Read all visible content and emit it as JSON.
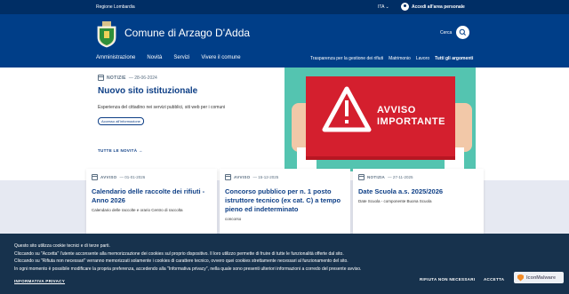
{
  "topbar": {
    "region": "Regione Lombardia",
    "language": "ITA",
    "login": "Accedi all'area personale"
  },
  "header": {
    "site_title": "Comune di Arzago D'Adda",
    "search_label": "Cerca",
    "nav_main": [
      "Amministrazione",
      "Novità",
      "Servizi",
      "Vivere il comune"
    ],
    "nav_secondary": [
      "Trasparenza per la gestione dei rifiuti",
      "Matrimonio",
      "Lavoro"
    ],
    "nav_all": "Tutti gli argomenti"
  },
  "featured": {
    "category": "NOTIZIE",
    "date": "— 28-06-2024",
    "title": "Nuovo sito istituzionale",
    "description": "Esperienza del cittadino nei servizi pubblici, siti web per i comuni",
    "tag": "Accesso all'informazione",
    "all_news": "TUTTE LE NOVITÀ"
  },
  "hero": {
    "sign_line1": "AVVISO",
    "sign_line2": "IMPORTANTE"
  },
  "cards": [
    {
      "category": "AVVISO",
      "date": "— 01-01-2026",
      "title": "Calendario delle raccolte dei rifiuti - Anno 2026",
      "description": "Calendario delle raccolte e orario Centro di raccolta"
    },
    {
      "category": "AVVISO",
      "date": "— 15-12-2025",
      "title": "Concorso pubblico per n. 1 posto istruttore tecnico (ex cat. C) a tempo pieno ed indeterminato",
      "description": "concorso"
    },
    {
      "category": "NOTIZIA",
      "date": "— 27-11-2025",
      "title": "Date Scuola a.s. 2025/2026",
      "description": "Date Scuola - componente Buona Scuola"
    }
  ],
  "cookie": {
    "lines": [
      "Questo sito utilizza cookie tecnici e di terze parti.",
      "Cliccando su \"Accetta\" l'utente acconsente alla memorizzazione dei cookies sul proprio dispositivo. Il loro utilizzo permette di fruire di tutte le funzionalità offerte dal sito.",
      "Cliccando su \"Rifiuta non necessari\" verranno memorizzati solamente i cookies di carattere tecnico, ovvero quei cookies strettamente necessari al funzionamento del sito.",
      "In ogni momento è possibile modificare la propria preferenza, accedendo alla \"Informativa privacy\", nella quale sono presenti ulteriori informazioni a corredo del presente avviso."
    ],
    "privacy_link": "INFORMATIVA PRIVACY",
    "reject": "RIFIUTA NON NECESSARI",
    "accept": "ACCETTA"
  },
  "badge": {
    "label": "IconMalware"
  },
  "colors": {
    "header": "#003e88",
    "topbar": "#002e65",
    "accent": "#0e3f86",
    "hero_bg": "#54c4b0",
    "sign": "#d41f2e",
    "cookie_bg": "#17324d"
  }
}
